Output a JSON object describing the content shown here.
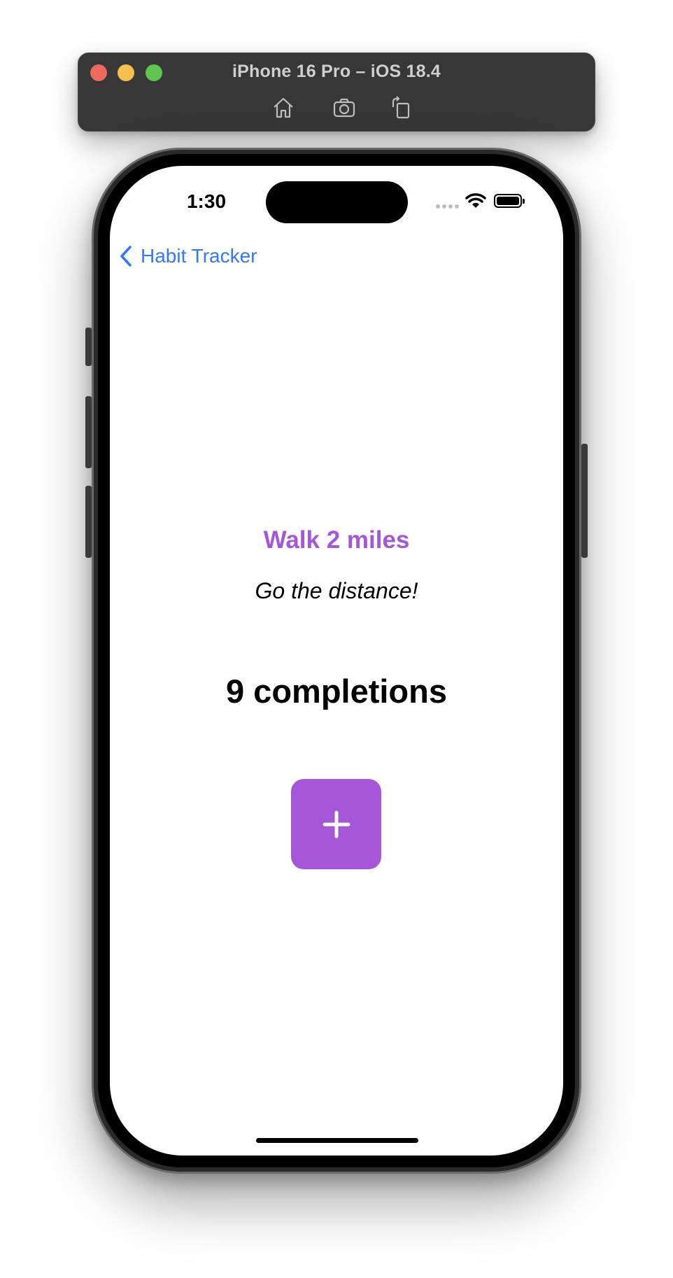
{
  "simulator": {
    "title": "iPhone 16 Pro – iOS 18.4",
    "toolbar": [
      {
        "name": "home-icon"
      },
      {
        "name": "screenshot-icon"
      },
      {
        "name": "rotate-icon"
      }
    ]
  },
  "status_bar": {
    "time": "1:30",
    "icons": [
      "cellular-icon",
      "wifi-icon",
      "battery-icon"
    ]
  },
  "nav": {
    "back_label": "Habit Tracker",
    "back_icon": "chevron-left-icon"
  },
  "habit": {
    "title": "Walk 2 miles",
    "description": "Go the distance!",
    "completions_text": "9 completions",
    "add_icon": "plus-icon"
  },
  "colors": {
    "accent": "#a557d8",
    "link": "#3478f6",
    "simulator_bar": "#373737"
  }
}
